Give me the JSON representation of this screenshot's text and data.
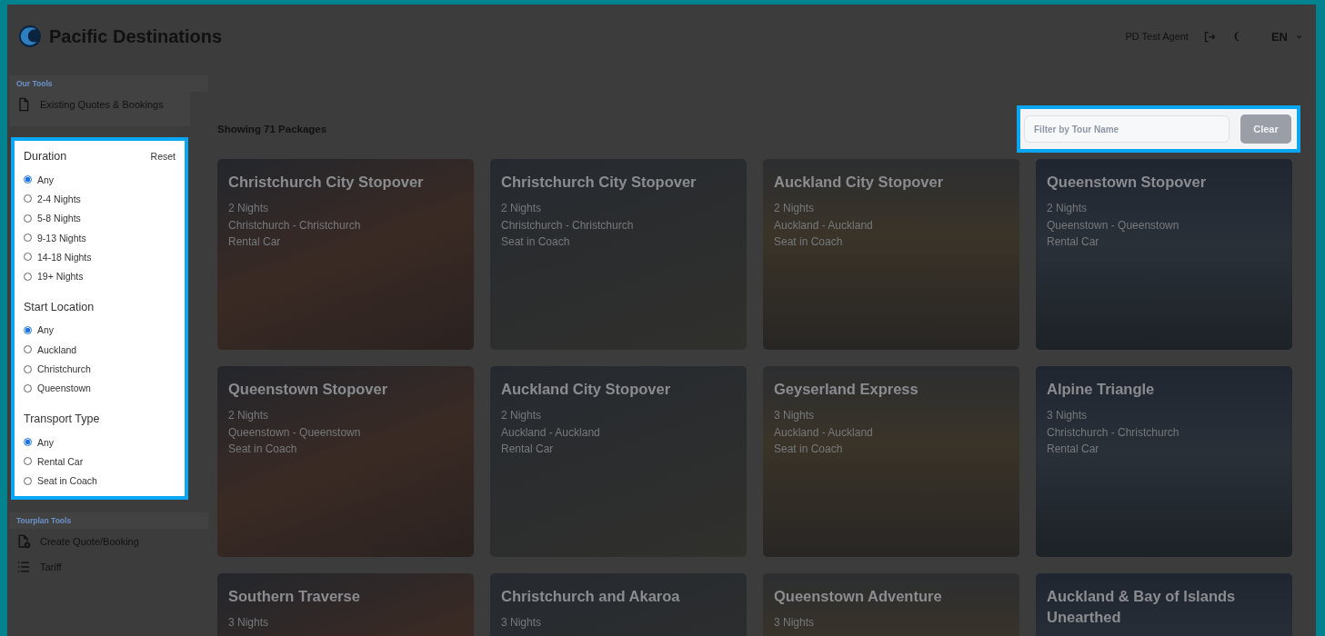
{
  "header": {
    "brand": "Pacific Destinations",
    "user": "PD Test Agent",
    "language": "EN"
  },
  "sidebar": {
    "sections": [
      {
        "title": "Our Tools",
        "items": [
          {
            "label": "Existing Quotes & Bookings",
            "kind": "document"
          }
        ]
      },
      {
        "title": "Tourplan Tools",
        "items": [
          {
            "label": "Create Quote/Booking",
            "kind": "new-document"
          },
          {
            "label": "Tariff",
            "kind": "list"
          }
        ]
      }
    ],
    "filters": {
      "reset": "Reset",
      "groups": [
        {
          "title": "Duration",
          "options": [
            {
              "label": "Any",
              "selected": true
            },
            {
              "label": "2-4 Nights",
              "selected": false
            },
            {
              "label": "5-8 Nights",
              "selected": false
            },
            {
              "label": "9-13 Nights",
              "selected": false
            },
            {
              "label": "14-18 Nights",
              "selected": false
            },
            {
              "label": "19+ Nights",
              "selected": false
            }
          ]
        },
        {
          "title": "Start Location",
          "options": [
            {
              "label": "Any",
              "selected": true
            },
            {
              "label": "Auckland",
              "selected": false
            },
            {
              "label": "Christchurch",
              "selected": false
            },
            {
              "label": "Queenstown",
              "selected": false
            }
          ]
        },
        {
          "title": "Transport Type",
          "options": [
            {
              "label": "Any",
              "selected": true
            },
            {
              "label": "Rental Car",
              "selected": false
            },
            {
              "label": "Seat in Coach",
              "selected": false
            }
          ]
        }
      ]
    }
  },
  "results": {
    "count_label": "Showing 71 Packages",
    "search": {
      "placeholder": "Filter by Tour Name"
    },
    "clear_button": "Clear"
  },
  "packages": [
    {
      "title": "Christchurch City Stopover",
      "nights": "2 Nights",
      "route": "Christchurch - Christchurch",
      "transport": "Rental Car"
    },
    {
      "title": "Christchurch City Stopover",
      "nights": "2 Nights",
      "route": "Christchurch - Christchurch",
      "transport": "Seat in Coach"
    },
    {
      "title": "Auckland City Stopover",
      "nights": "2 Nights",
      "route": "Auckland - Auckland",
      "transport": "Seat in Coach"
    },
    {
      "title": "Queenstown Stopover",
      "nights": "2 Nights",
      "route": "Queenstown - Queenstown",
      "transport": "Rental Car"
    },
    {
      "title": "Queenstown Stopover",
      "nights": "2 Nights",
      "route": "Queenstown - Queenstown",
      "transport": "Seat in Coach"
    },
    {
      "title": "Auckland City Stopover",
      "nights": "2 Nights",
      "route": "Auckland - Auckland",
      "transport": "Rental Car"
    },
    {
      "title": "Geyserland Express",
      "nights": "3 Nights",
      "route": "Auckland - Auckland",
      "transport": "Seat in Coach"
    },
    {
      "title": "Alpine Triangle",
      "nights": "3 Nights",
      "route": "Christchurch - Christchurch",
      "transport": "Rental Car"
    },
    {
      "title": "Southern Traverse",
      "nights": "3 Nights"
    },
    {
      "title": "Christchurch and Akaroa",
      "nights": "3 Nights"
    },
    {
      "title": "Queenstown Adventure",
      "nights": "3 Nights"
    },
    {
      "title": "Auckland & Bay of Islands Unearthed"
    }
  ]
}
